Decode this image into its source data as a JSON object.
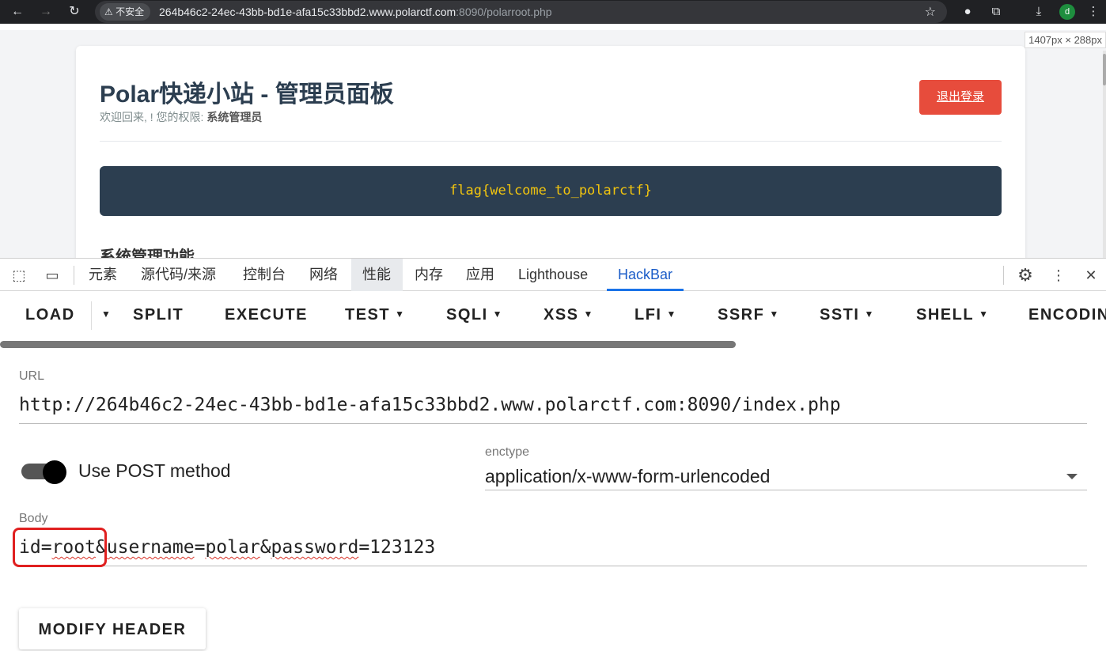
{
  "browser": {
    "security_label": "不安全",
    "url_main": "264b46c2-24ec-43bb-bd1e-afa15c33bbd2.www.polarctf.com",
    "url_rest": ":8090/polarroot.php",
    "profile_initial": "d",
    "viewport_size_label": "1407px × 288px"
  },
  "page": {
    "title": "Polar快递小站 - 管理员面板",
    "welcome_prefix": "欢迎回来, ! 您的权限: ",
    "role": "系统管理员",
    "logout_label": "退出登录",
    "flag": "flag{welcome_to_polarctf}",
    "section_title": "系统管理功能"
  },
  "devtools": {
    "tabs": [
      "元素",
      "源代码/来源",
      "控制台",
      "网络",
      "性能",
      "内存",
      "应用",
      "Lighthouse",
      "HackBar"
    ],
    "highlighted_tab": "性能",
    "selected_tab": "HackBar"
  },
  "hackbar": {
    "toolbar": [
      "LOAD",
      "SPLIT",
      "EXECUTE",
      "TEST",
      "SQLI",
      "XSS",
      "LFI",
      "SSRF",
      "SSTI",
      "SHELL",
      "ENCODIN"
    ],
    "url_label": "URL",
    "url_value": "http://264b46c2-24ec-43bb-bd1e-afa15c33bbd2.www.polarctf.com:8090/index.php",
    "post_toggle_label": "Use POST method",
    "post_enabled": true,
    "enctype_label": "enctype",
    "enctype_value": "application/x-www-form-urlencoded",
    "body_label": "Body",
    "body_parts": {
      "p1": "id=",
      "p2": "root",
      "p3": "&",
      "p4": "username",
      "p5": "=",
      "p6": "polar",
      "p7": "&",
      "p8": "password",
      "p9": "=123123"
    },
    "modify_header_label": "MODIFY HEADER"
  },
  "colors": {
    "accent": "#1a73e8",
    "logout": "#e74c3c",
    "flag_bg": "#2c3e50",
    "flag_text": "#f1c40f",
    "highlight_box": "#e02020"
  }
}
